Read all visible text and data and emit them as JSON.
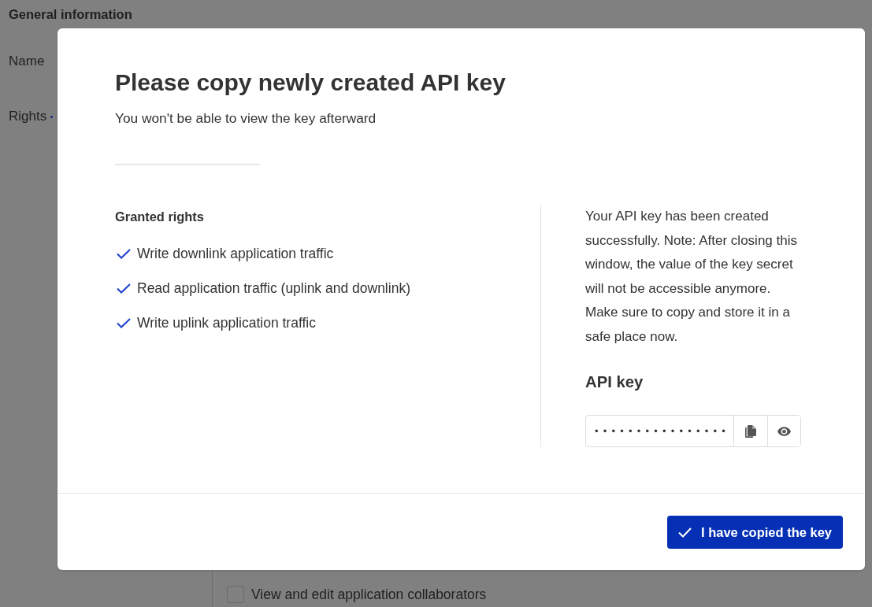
{
  "background": {
    "section_title": "General information",
    "fields": [
      {
        "label": "Name",
        "required": false
      },
      {
        "label": "Rights",
        "required": true
      }
    ],
    "rights_options": [
      {
        "label": "View and edit application collaborators",
        "checked": false
      }
    ]
  },
  "dialog": {
    "title": "Please copy newly created API key",
    "subtitle": "You won't be able to view the key afterward",
    "granted_rights": {
      "heading": "Granted rights",
      "items": [
        "Write downlink application traffic",
        "Read application traffic (uplink and downlink)",
        "Write uplink application traffic"
      ]
    },
    "note": "Your API key has been created successfully. Note: After closing this window, the value of the key secret will not be accessible anymore. Make sure to copy and store it in a safe place now.",
    "api_key": {
      "label": "API key",
      "value": "••••••••••••••••"
    },
    "confirm_button": "I have copied the key"
  }
}
